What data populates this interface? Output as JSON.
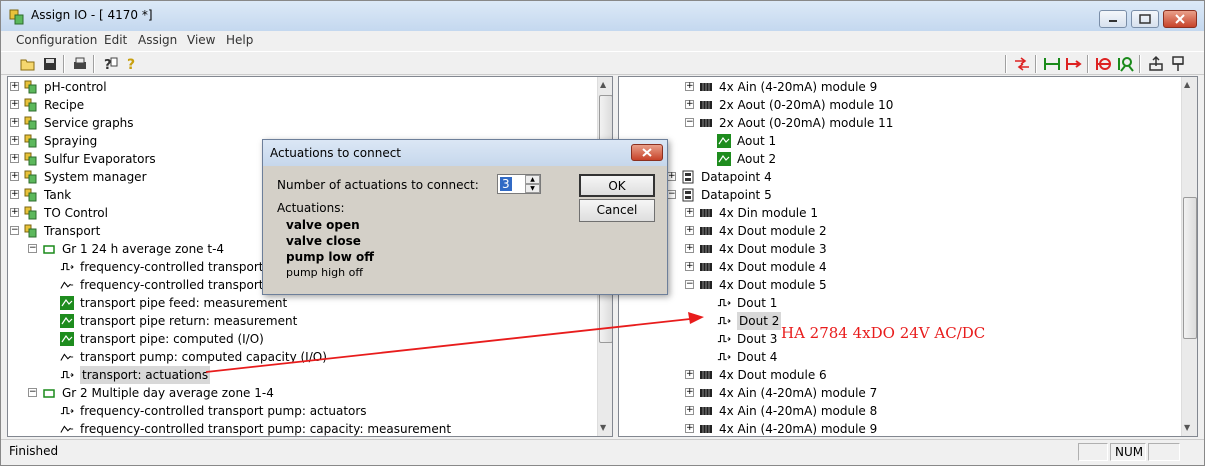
{
  "window": {
    "title": "Assign IO - [ 4170  *]"
  },
  "menu": [
    "Configuration",
    "Edit",
    "Assign",
    "View",
    "Help"
  ],
  "toolbar_icons": [
    "open-icon",
    "save-icon",
    "print-icon",
    "help-context-icon",
    "help-icon",
    "connect-icon",
    "connect-range-icon",
    "disconnect-icon",
    "actuation-icon",
    "find-icon",
    "move-up-icon",
    "pin-icon"
  ],
  "left_tree": [
    {
      "label": "pH-control",
      "type": "folder",
      "level": 0,
      "expander": "+"
    },
    {
      "label": "Recipe",
      "type": "folder",
      "level": 0,
      "expander": "+"
    },
    {
      "label": "Service graphs",
      "type": "folder",
      "level": 0,
      "expander": "+"
    },
    {
      "label": "Spraying",
      "type": "folder",
      "level": 0,
      "expander": "+"
    },
    {
      "label": "Sulfur Evaporators",
      "type": "folder",
      "level": 0,
      "expander": "+"
    },
    {
      "label": "System manager",
      "type": "folder",
      "level": 0,
      "expander": "+"
    },
    {
      "label": "Tank",
      "type": "folder",
      "level": 0,
      "expander": "+"
    },
    {
      "label": "TO Control",
      "type": "folder",
      "level": 0,
      "expander": "+"
    },
    {
      "label": "Transport",
      "type": "folder",
      "level": 0,
      "expander": "-"
    },
    {
      "label": "Gr 1 24 h average zone t-4",
      "type": "group",
      "level": 1,
      "expander": "-"
    },
    {
      "label": "frequency-controlled  transport p",
      "type": "digital",
      "level": 2
    },
    {
      "label": "frequency-controlled transport p",
      "type": "analog",
      "level": 2
    },
    {
      "label": "transport pipe feed: measurement",
      "type": "green",
      "level": 2
    },
    {
      "label": "transport pipe return: measurement",
      "type": "green",
      "level": 2
    },
    {
      "label": "transport pipe: computed (I/O)",
      "type": "green",
      "level": 2
    },
    {
      "label": "transport pump: computed capacity (I/O)",
      "type": "analog",
      "level": 2
    },
    {
      "label": "transport: actuations",
      "type": "digital",
      "level": 2,
      "selected": true
    },
    {
      "label": "Gr 2 Multiple day average zone 1-4",
      "type": "group",
      "level": 1,
      "expander": "-"
    },
    {
      "label": "frequency-controlled  transport pump: actuators",
      "type": "digital",
      "level": 2
    },
    {
      "label": "frequency-controlled transport pump: capacity: measurement",
      "type": "analog",
      "level": 2
    }
  ],
  "right_tree": [
    {
      "label": "4x Ain (4-20mA) module 9",
      "type": "module",
      "level": 1,
      "expander": "+"
    },
    {
      "label": "2x Aout (0-20mA) module 10",
      "type": "module",
      "level": 1,
      "expander": "+"
    },
    {
      "label": "2x Aout (0-20mA) module 11",
      "type": "module",
      "level": 1,
      "expander": "-"
    },
    {
      "label": "Aout 1",
      "type": "green",
      "level": 2
    },
    {
      "label": "Aout 2",
      "type": "green",
      "level": 2
    },
    {
      "label": "Datapoint 4",
      "type": "datapoint",
      "level": 0,
      "expander": "+"
    },
    {
      "label": "Datapoint 5",
      "type": "datapoint",
      "level": 0,
      "expander": "-"
    },
    {
      "label": "4x Din module 1",
      "type": "module",
      "level": 1,
      "expander": "+"
    },
    {
      "label": "4x Dout module 2",
      "type": "module",
      "level": 1,
      "expander": "+"
    },
    {
      "label": "4x Dout module 3",
      "type": "module",
      "level": 1,
      "expander": "+"
    },
    {
      "label": "4x Dout module 4",
      "type": "module",
      "level": 1,
      "expander": "+"
    },
    {
      "label": "4x Dout module 5",
      "type": "module",
      "level": 1,
      "expander": "-"
    },
    {
      "label": "Dout 1",
      "type": "digital",
      "level": 2
    },
    {
      "label": "Dout 2",
      "type": "digital",
      "level": 2,
      "selected": true
    },
    {
      "label": "Dout 3",
      "type": "digital",
      "level": 2
    },
    {
      "label": "Dout 4",
      "type": "digital",
      "level": 2
    },
    {
      "label": "4x Dout module 6",
      "type": "module",
      "level": 1,
      "expander": "+"
    },
    {
      "label": "4x Ain (4-20mA) module 7",
      "type": "module",
      "level": 1,
      "expander": "+"
    },
    {
      "label": "4x Ain (4-20mA) module 8",
      "type": "module",
      "level": 1,
      "expander": "+"
    },
    {
      "label": "4x Ain (4-20mA) module 9",
      "type": "module",
      "level": 1,
      "expander": "+"
    }
  ],
  "dialog": {
    "title": "Actuations to connect",
    "count_label": "Number of actuations to connect:",
    "count_value": "3",
    "actuations_label": "Actuations:",
    "actuations": [
      {
        "label": "valve open",
        "bold": true
      },
      {
        "label": "valve close",
        "bold": true
      },
      {
        "label": "pump low off",
        "bold": true
      },
      {
        "label": "pump high off",
        "bold": false
      }
    ],
    "ok_label": "OK",
    "cancel_label": "Cancel"
  },
  "annotation": {
    "text": "HA 2784 4xDO 24V AC/DC",
    "color": "#e81c1c"
  },
  "status": {
    "text": "Finished",
    "num": "NUM"
  }
}
